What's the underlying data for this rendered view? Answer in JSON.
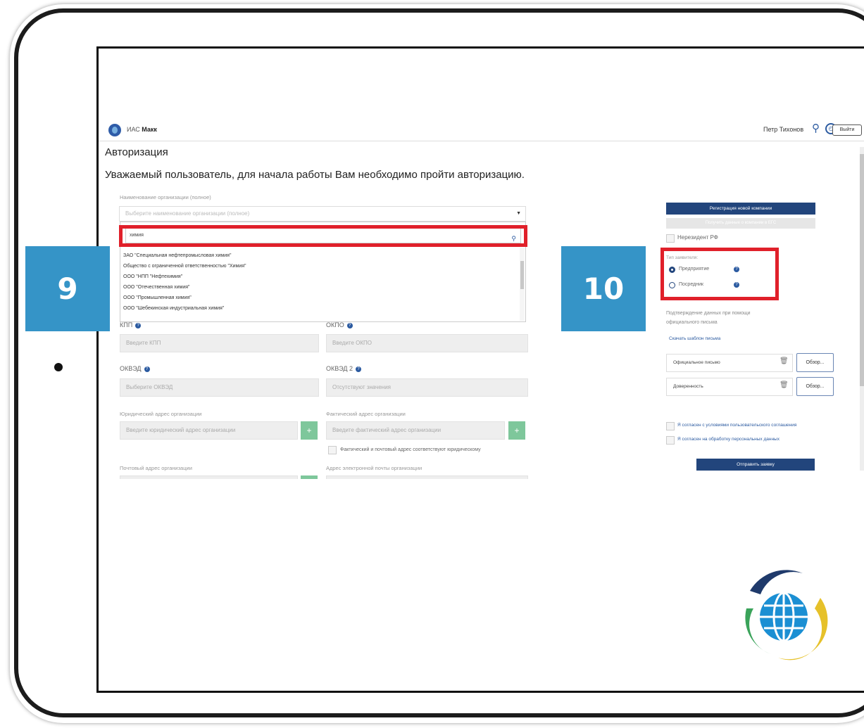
{
  "header": {
    "app_title_prefix": "ИАС",
    "app_title_name": "Макк",
    "user_name": "Петр Тихонов",
    "logout_label": "Выйти"
  },
  "page": {
    "title": "Авторизация",
    "subtitle": "Уважаемый пользователь, для начала работы Вам необходимо пройти авторизацию."
  },
  "org_select": {
    "label": "Наименование организации (полное)",
    "placeholder": "Выберите наименование организации (полное)",
    "search_value": "химия",
    "options": [
      "ЗАО \"Специальная нефтепромысловая химия\"",
      "Общество с ограниченной ответственностью \"Химия\"",
      "ООО \"НПП \"Нефтехимия\"",
      "ООО \"Отечественная химия\"",
      "ООО \"Промышленная химия\"",
      "ООО \"Шебекинская индустриальная химия\""
    ]
  },
  "fields": {
    "kpp_label": "КПП",
    "kpp_placeholder": "Введите КПП",
    "okpo_label": "ОКПО",
    "okpo_placeholder": "Введите ОКПО",
    "okved_label": "ОКВЭД",
    "okved_placeholder": "Выберите ОКВЭД",
    "okved2_label": "ОКВЭД 2",
    "okved2_placeholder": "Отсутствуют значения",
    "legal_addr_label": "Юридический адрес организации",
    "legal_addr_placeholder": "Введите юридический адрес организации",
    "actual_addr_label": "Фактический адрес организации",
    "actual_addr_placeholder": "Введите фактический адрес организации",
    "same_addr_label": "Фактический и почтовый адрес соответствуют юридическому",
    "postal_addr_label": "Почтовый адрес организации",
    "email_label": "Адрес электронной почты организации",
    "plus_glyph": "+"
  },
  "right_panel": {
    "register_btn": "Регистрация новой компании",
    "get_data_btn": "Получить данные о компании в ЕГС",
    "nonresident_label": "Нерезидент РФ",
    "applicant_type_label": "Тип заявителя:",
    "applicant_types": [
      "Предприятие",
      "Посредник"
    ],
    "selected_type": "Предприятие",
    "confirm_label_1": "Подтверждение данных при помощи",
    "confirm_label_2": "официального письма",
    "download_template": "Скачать шаблон письма",
    "file1_label": "Официальное письмо",
    "file2_label": "Доверенность",
    "browse_label": "Обзор...",
    "agree_terms": "Я согласен с условиями пользовательского соглашения",
    "agree_personal": "Я согласен на обработку персональных данных",
    "submit_btn": "Отправить заявку"
  },
  "badges": {
    "left": "9",
    "right": "10"
  },
  "colors": {
    "accent": "#22457c",
    "highlight": "#e0202a",
    "badge": "#3594c7",
    "plus_btn": "#7ec79b"
  }
}
